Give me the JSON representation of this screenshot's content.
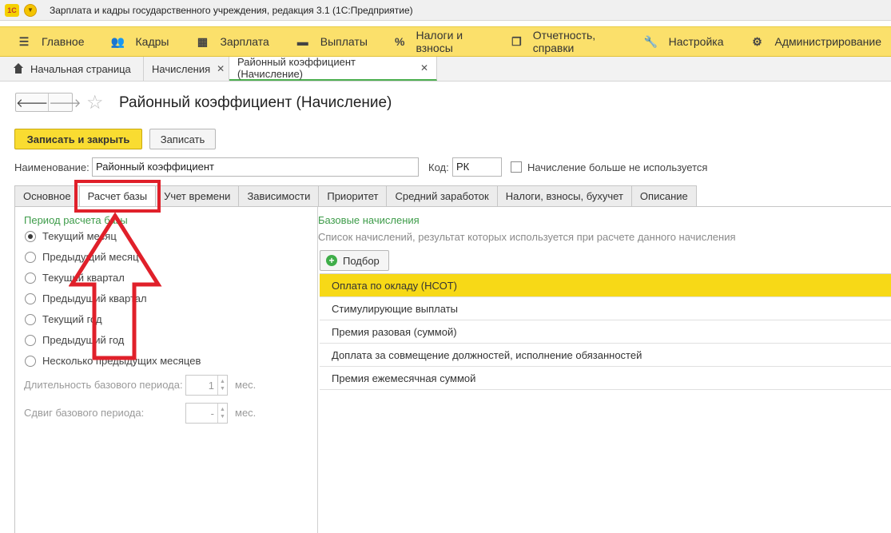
{
  "window": {
    "title": "Зарплата и кадры государственного учреждения, редакция 3.1  (1С:Предприятие)",
    "logo": "1С"
  },
  "menu": [
    {
      "label": "Главное",
      "icon": "hamburger-icon",
      "glyph": "☰"
    },
    {
      "label": "Кадры",
      "icon": "people-icon",
      "glyph": "👥"
    },
    {
      "label": "Зарплата",
      "icon": "calculator-icon",
      "glyph": "▦"
    },
    {
      "label": "Выплаты",
      "icon": "wallet-icon",
      "glyph": "▬"
    },
    {
      "label": "Налоги и взносы",
      "icon": "percent-icon",
      "glyph": "%"
    },
    {
      "label": "Отчетность, справки",
      "icon": "documents-icon",
      "glyph": "❐"
    },
    {
      "label": "Настройка",
      "icon": "wrench-icon",
      "glyph": "🔧"
    },
    {
      "label": "Администрирование",
      "icon": "gear-icon",
      "glyph": "⚙"
    }
  ],
  "open_tabs": [
    {
      "label": "Начальная страница",
      "closable": false
    },
    {
      "label": "Начисления",
      "closable": true,
      "close": "✕"
    },
    {
      "label": "Районный коэффициент (Начисление)",
      "closable": true,
      "close": "✕",
      "active": true
    }
  ],
  "form": {
    "title": "Районный коэффициент (Начисление)",
    "nav_back": "🡐",
    "nav_forward": "🡒",
    "favorite": "☆",
    "save_close_label": "Записать и закрыть",
    "save_label": "Записать",
    "name_label": "Наименование:",
    "name_value": "Районный коэффициент",
    "code_label": "Код:",
    "code_value": "РК",
    "unused_label": "Начисление больше не используется"
  },
  "tabs": [
    "Основное",
    "Расчет базы",
    "Учет времени",
    "Зависимости",
    "Приоритет",
    "Средний заработок",
    "Налоги, взносы, бухучет",
    "Описание"
  ],
  "active_tab": 1,
  "period": {
    "title": "Период расчета базы",
    "options": [
      "Текущий месяц",
      "Предыдущий месяц",
      "Текущий квартал",
      "Предыдущий квартал",
      "Текущий год",
      "Предыдущий год",
      "Несколько предыдущих месяцев"
    ],
    "selected": 0,
    "duration_label": "Длительность базового периода:",
    "duration_value": "1",
    "shift_label": "Сдвиг базового периода:",
    "shift_value": "-",
    "unit": "мес."
  },
  "base": {
    "title": "Базовые начисления",
    "description": "Список начислений, результат которых используется при расчете данного начисления",
    "add_label": "Подбор",
    "items": [
      "Оплата по окладу (НСОТ)",
      "Стимулирующие выплаты",
      "Премия разовая (суммой)",
      "Доплата за совмещение должностей, исполнение обязанностей",
      "Премия ежемесячная суммой"
    ],
    "selected": 0
  },
  "colors": {
    "menu_bg": "#fbe06b",
    "accent_yellow": "#f9dc31",
    "group_title": "#3e9c4a",
    "annotation_red": "#e0202a"
  }
}
